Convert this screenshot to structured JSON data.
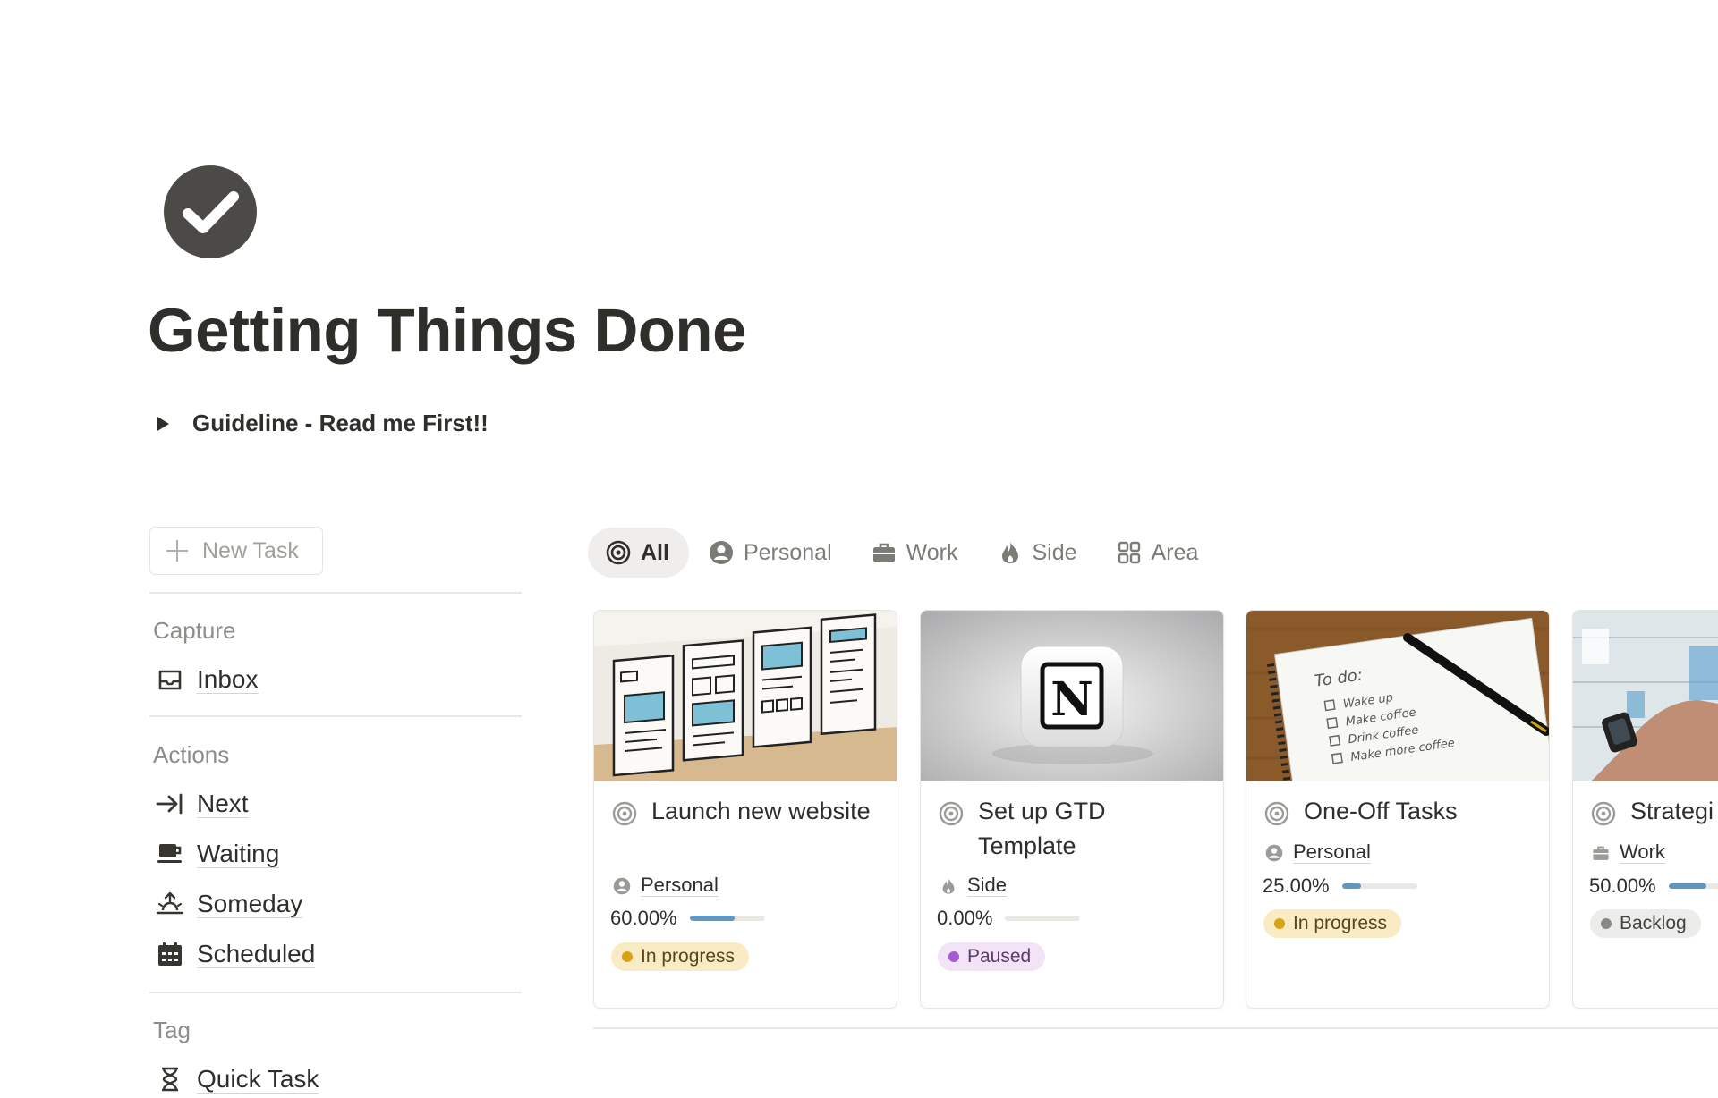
{
  "page": {
    "icon": "check-circle-icon",
    "title": "Getting Things Done",
    "toggle_label": "Guideline - Read me First!!"
  },
  "sidebar": {
    "new_task_label": "New Task",
    "sections": [
      {
        "label": "Capture",
        "items": [
          {
            "label": "Inbox",
            "icon": "inbox-tray-icon"
          }
        ]
      },
      {
        "label": "Actions",
        "items": [
          {
            "label": "Next",
            "icon": "arrow-to-bar-icon"
          },
          {
            "label": "Waiting",
            "icon": "coffee-cup-icon"
          },
          {
            "label": "Someday",
            "icon": "sunrise-icon"
          },
          {
            "label": "Scheduled",
            "icon": "calendar-icon"
          }
        ]
      },
      {
        "label": "Tag",
        "items": [
          {
            "label": "Quick Task",
            "icon": "hourglass-icon"
          }
        ]
      }
    ]
  },
  "tabs": [
    {
      "label": "All",
      "icon": "target-icon",
      "active": true
    },
    {
      "label": "Personal",
      "icon": "person-circle-icon",
      "active": false
    },
    {
      "label": "Work",
      "icon": "briefcase-icon",
      "active": false
    },
    {
      "label": "Side",
      "icon": "flame-icon",
      "active": false
    },
    {
      "label": "Area",
      "icon": "grid-icon",
      "active": false
    }
  ],
  "cards": [
    {
      "title": "Launch new website",
      "category": "Personal",
      "category_icon": "person-circle-icon",
      "progress_text": "60.00%",
      "progress": 0.6,
      "status": "In progress",
      "status_kind": "in-progress"
    },
    {
      "title": "Set up GTD Template",
      "category": "Side",
      "category_icon": "flame-icon",
      "progress_text": "0.00%",
      "progress": 0.0,
      "status": "Paused",
      "status_kind": "paused"
    },
    {
      "title": "One-Off Tasks",
      "category": "Personal",
      "category_icon": "person-circle-icon",
      "progress_text": "25.00%",
      "progress": 0.25,
      "status": "In progress",
      "status_kind": "in-progress"
    },
    {
      "title": "Strategi",
      "category": "Work",
      "category_icon": "briefcase-icon",
      "progress_text": "50.00%",
      "progress": 0.5,
      "status": "Backlog",
      "status_kind": "backlog"
    }
  ],
  "colors": {
    "progress_fill": "#5d97c2",
    "in_progress_bg": "#f9ecc4",
    "in_progress_dot": "#d9a215",
    "in_progress_text": "#5a4419",
    "paused_bg": "#f2e3f7",
    "paused_dot": "#a45bd1",
    "paused_text": "#5b3a6e",
    "backlog_bg": "#ececea",
    "backlog_dot": "#8a8884",
    "backlog_text": "#45433f"
  },
  "cover_texts": {
    "notion_letter": "N",
    "todo_heading": "To do:",
    "todo_lines": [
      "Wake up",
      "Make coffee",
      "Drink coffee",
      "Make more coffee"
    ]
  }
}
